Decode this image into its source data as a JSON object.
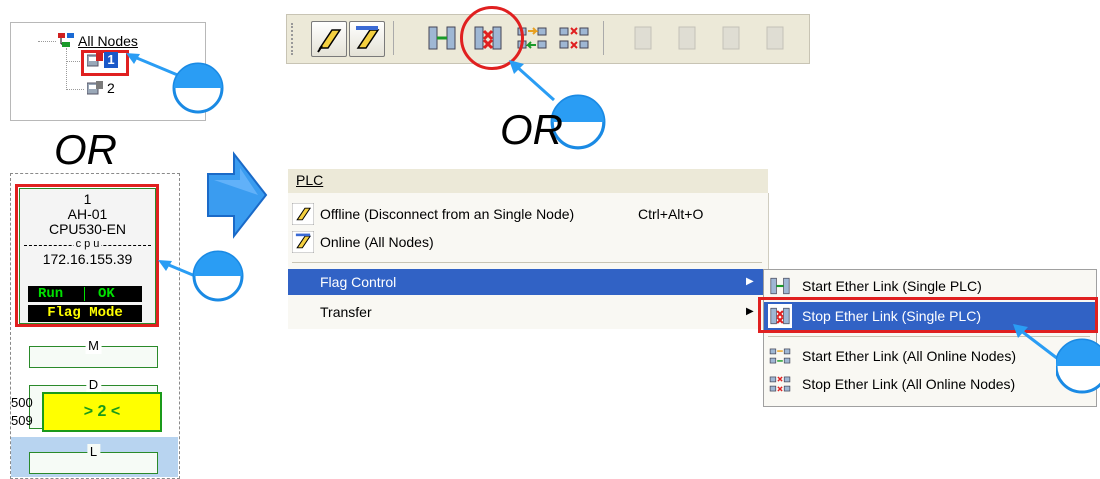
{
  "tree": {
    "root_label": "All Nodes",
    "node1_label": "1",
    "node2_label": "2"
  },
  "or_label": "OR",
  "card": {
    "station": "1",
    "model": "AH-01",
    "cpu": "CPU530-EN",
    "cpu_sep": "c p u",
    "ip": "172.16.155.39",
    "status_run": "Run",
    "status_ok": "OK",
    "mode": "Flag Mode",
    "slot_m": "M",
    "slot_d": "D",
    "slot_l": "L",
    "range_start": "500",
    "range_end": "509",
    "highlight_value": "> 2 <"
  },
  "menu": {
    "title": "PLC",
    "items": [
      {
        "label": "Offline (Disconnect from an Single Node)",
        "shortcut": "Ctrl+Alt+O"
      },
      {
        "label": "Online (All Nodes)",
        "shortcut": ""
      },
      {
        "label": "Flag Control",
        "shortcut": ""
      },
      {
        "label": "Transfer",
        "shortcut": ""
      }
    ]
  },
  "submenu": {
    "items": [
      {
        "label": "Start Ether Link (Single PLC)"
      },
      {
        "label": "Stop Ether Link (Single PLC)"
      },
      {
        "label": "Start Ether Link (All Online Nodes)"
      },
      {
        "label": "Stop Ether Link (All Online Nodes)"
      }
    ]
  },
  "colors": {
    "highlight_red": "#e02020",
    "menu_selected": "#3162c5",
    "arrow_blue": "#2a9df4",
    "status_green": "#00e000",
    "mode_yellow": "#ffff00",
    "slot_yellow": "#ffff00"
  },
  "icons": [
    "hierarchy-icon",
    "plc-node-icon",
    "pie-clock-icon",
    "offline-plug-icon",
    "online-plug-icon",
    "start-ether-link-icon",
    "stop-ether-link-icon",
    "start-all-link-icon",
    "stop-all-link-icon",
    "blue-right-arrow-icon",
    "submenu-arrow-icon"
  ]
}
